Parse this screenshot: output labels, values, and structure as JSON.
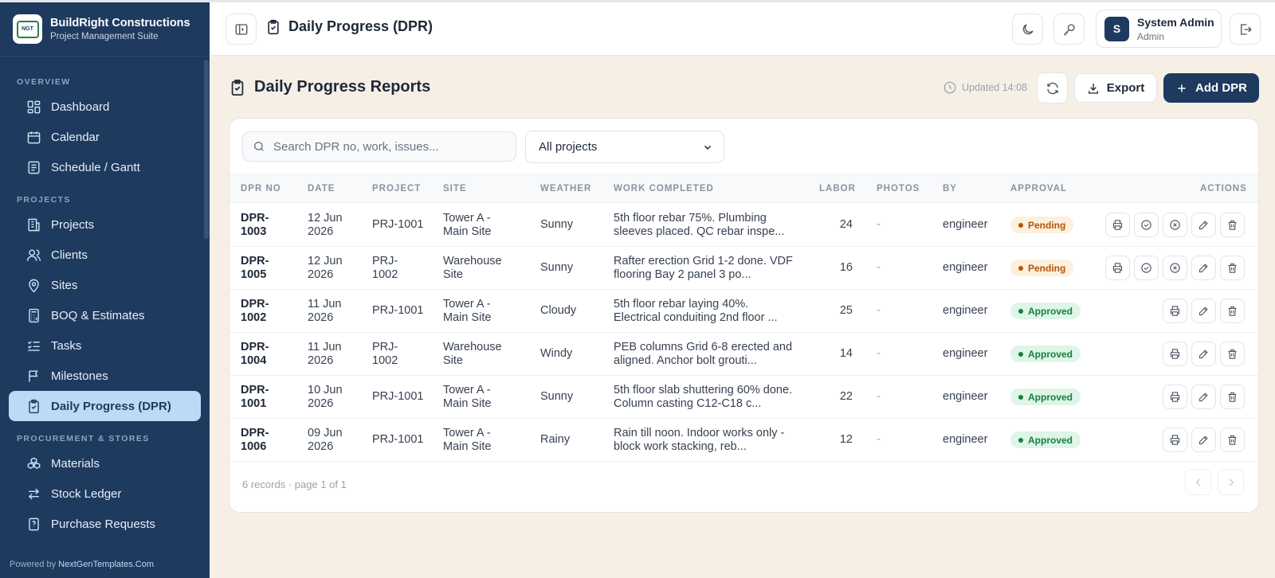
{
  "brand": {
    "name": "BuildRight Constructions",
    "subtitle": "Project Management Suite",
    "logo_text": "NGT"
  },
  "sidebar": {
    "sections": [
      {
        "label": "OVERVIEW"
      },
      {
        "label": "PROJECTS"
      },
      {
        "label": "PROCUREMENT & STORES"
      }
    ],
    "items": [
      {
        "label": "Dashboard",
        "icon": "grid-icon"
      },
      {
        "label": "Calendar",
        "icon": "calendar-icon"
      },
      {
        "label": "Schedule / Gantt",
        "icon": "schedule-icon"
      },
      {
        "label": "Projects",
        "icon": "building-icon"
      },
      {
        "label": "Clients",
        "icon": "users-icon"
      },
      {
        "label": "Sites",
        "icon": "map-pin-icon"
      },
      {
        "label": "BOQ & Estimates",
        "icon": "calculator-icon"
      },
      {
        "label": "Tasks",
        "icon": "list-check-icon"
      },
      {
        "label": "Milestones",
        "icon": "flag-icon"
      },
      {
        "label": "Daily Progress (DPR)",
        "icon": "clipboard-icon",
        "active": true
      },
      {
        "label": "Materials",
        "icon": "boxes-icon"
      },
      {
        "label": "Stock Ledger",
        "icon": "arrows-swap-icon"
      },
      {
        "label": "Purchase Requests",
        "icon": "file-question-icon"
      }
    ],
    "powered_by_prefix": "Powered by",
    "powered_by_link": "NextGenTemplates.Com"
  },
  "header": {
    "title": "Daily Progress (DPR)",
    "user_initial": "S",
    "user_name": "System Admin",
    "user_role": "Admin"
  },
  "page": {
    "title": "Daily Progress Reports",
    "updated": "Updated 14:08",
    "export_label": "Export",
    "add_label": "Add DPR"
  },
  "filters": {
    "search_placeholder": "Search DPR no, work, issues...",
    "project_select": "All projects"
  },
  "table": {
    "columns": [
      "DPR NO",
      "DATE",
      "PROJECT",
      "SITE",
      "WEATHER",
      "WORK COMPLETED",
      "LABOR",
      "PHOTOS",
      "BY",
      "APPROVAL",
      "ACTIONS"
    ],
    "rows": [
      {
        "dpr_l1": "DPR-",
        "dpr_l2": "1003",
        "date_l1": "12 Jun",
        "date_l2": "2026",
        "project_l1": "PRJ-1001",
        "project_l2": "",
        "site_l1": "Tower A -",
        "site_l2": "Main Site",
        "weather": "Sunny",
        "work_l1": "5th floor rebar 75%. Plumbing",
        "work_l2": "sleeves placed. QC rebar inspe...",
        "labor": "24",
        "photos": "-",
        "by": "engineer",
        "approval": "Pending"
      },
      {
        "dpr_l1": "DPR-",
        "dpr_l2": "1005",
        "date_l1": "12 Jun",
        "date_l2": "2026",
        "project_l1": "PRJ-",
        "project_l2": "1002",
        "site_l1": "Warehouse",
        "site_l2": "Site",
        "weather": "Sunny",
        "work_l1": "Rafter erection Grid 1-2 done. VDF",
        "work_l2": "flooring Bay 2 panel 3 po...",
        "labor": "16",
        "photos": "-",
        "by": "engineer",
        "approval": "Pending"
      },
      {
        "dpr_l1": "DPR-",
        "dpr_l2": "1002",
        "date_l1": "11 Jun",
        "date_l2": "2026",
        "project_l1": "PRJ-1001",
        "project_l2": "",
        "site_l1": "Tower A -",
        "site_l2": "Main Site",
        "weather": "Cloudy",
        "work_l1": "5th floor rebar laying 40%.",
        "work_l2": "Electrical conduiting 2nd floor ...",
        "labor": "25",
        "photos": "-",
        "by": "engineer",
        "approval": "Approved"
      },
      {
        "dpr_l1": "DPR-",
        "dpr_l2": "1004",
        "date_l1": "11 Jun",
        "date_l2": "2026",
        "project_l1": "PRJ-",
        "project_l2": "1002",
        "site_l1": "Warehouse",
        "site_l2": "Site",
        "weather": "Windy",
        "work_l1": "PEB columns Grid 6-8 erected and",
        "work_l2": "aligned. Anchor bolt grouti...",
        "labor": "14",
        "photos": "-",
        "by": "engineer",
        "approval": "Approved"
      },
      {
        "dpr_l1": "DPR-",
        "dpr_l2": "1001",
        "date_l1": "10 Jun",
        "date_l2": "2026",
        "project_l1": "PRJ-1001",
        "project_l2": "",
        "site_l1": "Tower A -",
        "site_l2": "Main Site",
        "weather": "Sunny",
        "work_l1": "5th floor slab shuttering 60% done.",
        "work_l2": "Column casting C12-C18 c...",
        "labor": "22",
        "photos": "-",
        "by": "engineer",
        "approval": "Approved"
      },
      {
        "dpr_l1": "DPR-",
        "dpr_l2": "1006",
        "date_l1": "09 Jun",
        "date_l2": "2026",
        "project_l1": "PRJ-1001",
        "project_l2": "",
        "site_l1": "Tower A -",
        "site_l2": "Main Site",
        "weather": "Rainy",
        "work_l1": "Rain till noon. Indoor works only -",
        "work_l2": "block work stacking, reb...",
        "labor": "12",
        "photos": "-",
        "by": "engineer",
        "approval": "Approved"
      }
    ],
    "footer": "6 records · page 1 of 1"
  },
  "colors": {
    "sidebar": "#1e3a5f",
    "accent": "#1e3a5f",
    "active_nav": "#bcdaf5",
    "page_bg": "#f5efe6",
    "pending": "#b45309",
    "approved": "#15803d"
  }
}
